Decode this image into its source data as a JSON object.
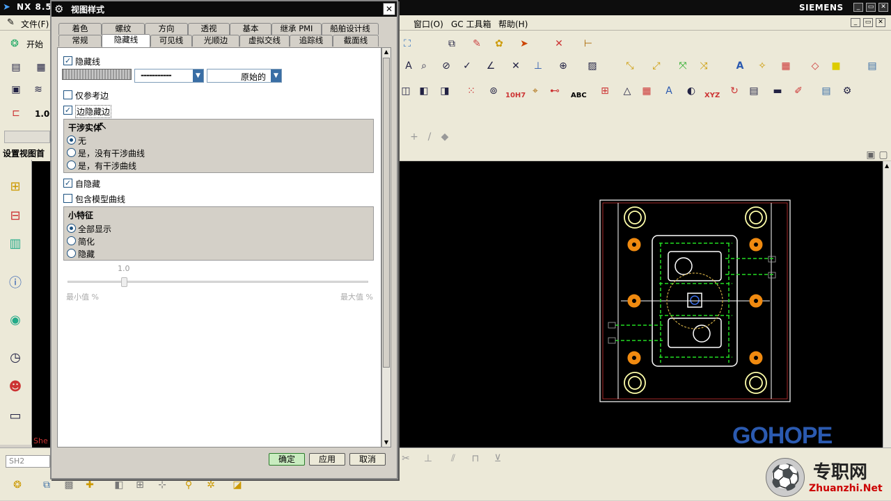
{
  "app": {
    "title": "NX 8.5",
    "brand": "SIEMENS",
    "menus": [
      "文件(F)",
      "窗口(O)",
      "GC 工具箱",
      "帮助(H)"
    ],
    "start_label": "开始",
    "scale_value": "1.00",
    "resource_label": "设置视图首选",
    "sheet_label": "She",
    "status_field": "SH2",
    "toolbar_text": [
      "10H7",
      "ABC",
      "XYZ"
    ]
  },
  "dialog": {
    "title": "视图样式",
    "close": "✕",
    "tabs_row1": [
      "着色",
      "螺纹",
      "方向",
      "透视",
      "基本",
      "继承 PMI",
      "船舶设计线"
    ],
    "tabs_row2": [
      "常规",
      "隐藏线",
      "可见线",
      "光顺边",
      "虚拟交线",
      "追踪线",
      "截面线"
    ],
    "active_tab": "隐藏线",
    "hidden_lines": {
      "label": "隐藏线",
      "checked": true
    },
    "line_style": "-----------",
    "line_width": "原始的",
    "ref_edges_only": {
      "label": "仅参考边",
      "checked": false
    },
    "edge_hidden_edges": {
      "label": "边隐藏边",
      "checked": true
    },
    "interference": {
      "title": "干涉实体",
      "options": [
        "无",
        "是，没有干涉曲线",
        "是，有干涉曲线"
      ],
      "selected": 0
    },
    "self_hidden": {
      "label": "自隐藏",
      "checked": true
    },
    "include_model_curves": {
      "label": "包含模型曲线",
      "checked": false
    },
    "small_features": {
      "title": "小特征",
      "options": [
        "全部显示",
        "简化",
        "隐藏"
      ],
      "selected": 0
    },
    "slider": {
      "value": "1.0",
      "level": 0.18,
      "min_label": "最小值 %",
      "max_label": "最大值 %"
    },
    "buttons": {
      "ok": "确定",
      "apply": "应用",
      "cancel": "取消"
    }
  },
  "watermark": {
    "brand": "GOHOPE",
    "site_cn": "专职网",
    "site_url": "Zhuanzhi.Net"
  },
  "colors": {
    "accent": "#1c5180",
    "drawing_border": "#ffffff",
    "hole_orange": "#f08a10",
    "hidden_green": "#22dd22"
  }
}
